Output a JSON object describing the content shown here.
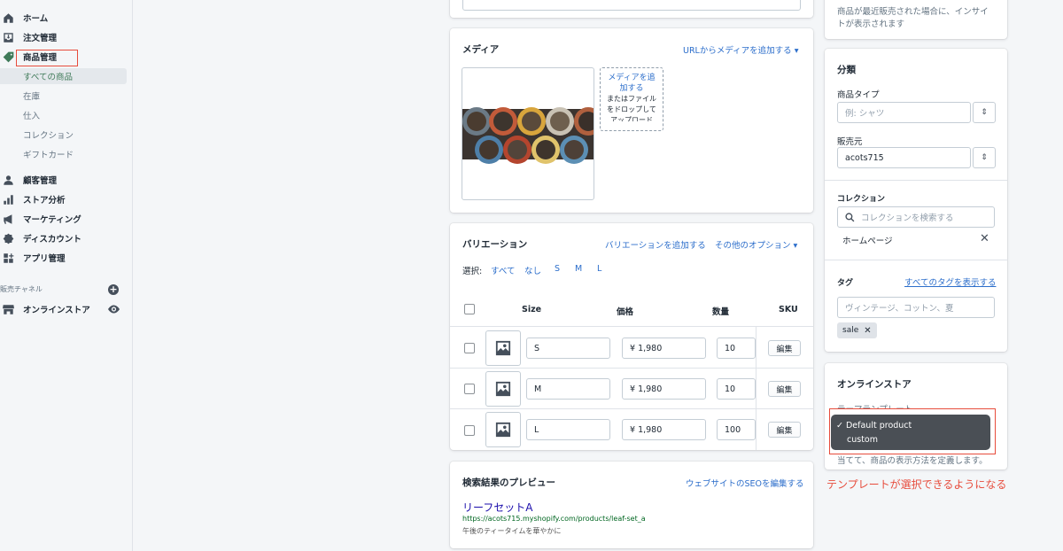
{
  "sidebar": {
    "items": [
      {
        "label": "ホーム",
        "icon": "home-icon"
      },
      {
        "label": "注文管理",
        "icon": "inbox-icon"
      },
      {
        "label": "商品管理",
        "icon": "tag-icon"
      },
      {
        "label": "顧客管理",
        "icon": "person-icon"
      },
      {
        "label": "ストア分析",
        "icon": "bar-chart-icon"
      },
      {
        "label": "マーケティング",
        "icon": "megaphone-icon"
      },
      {
        "label": "ディスカウント",
        "icon": "discount-icon"
      },
      {
        "label": "アプリ管理",
        "icon": "apps-icon"
      }
    ],
    "subitems": [
      "すべての商品",
      "在庫",
      "仕入",
      "コレクション",
      "ギフトカード"
    ],
    "channels_label": "販売チャネル",
    "online_store": "オンラインストア"
  },
  "media": {
    "title": "メディア",
    "add_url": "URLからメディアを追加する ▾",
    "drop_line1": "メディアを追",
    "drop_line2": "加する",
    "drop_line3": "またはファイル",
    "drop_line4": "をドロップして",
    "drop_line5": "アップロード"
  },
  "variants": {
    "title": "バリエーション",
    "add": "バリエーションを追加する",
    "more": "その他のオプション ▾",
    "select_label": "選択:",
    "select_options": [
      "すべて",
      "なし",
      "S",
      "M",
      "L"
    ],
    "headers": {
      "size": "Size",
      "price": "価格",
      "qty": "数量",
      "sku": "SKU"
    },
    "edit_label": "編集",
    "rows": [
      {
        "size": "S",
        "price": "¥  1,980",
        "qty": "10"
      },
      {
        "size": "M",
        "price": "¥  1,980",
        "qty": "10"
      },
      {
        "size": "L",
        "price": "¥  1,980",
        "qty": "100"
      }
    ]
  },
  "seo": {
    "title": "検索結果のプレビュー",
    "edit": "ウェブサイトのSEOを編集する",
    "page_title": "リーフセットA",
    "url": "https://acots715.myshopify.com/products/leaf-set_a",
    "description": "午後のティータイムを華やかに"
  },
  "insights": {
    "line1": "商品が最近販売された場合に、インサイ",
    "line2": "トが表示されます"
  },
  "org": {
    "title": "分類",
    "type_label": "商品タイプ",
    "type_placeholder": "例: シャツ",
    "vendor_label": "販売元",
    "vendor_value": "acots715",
    "collection_label": "コレクション",
    "collection_placeholder": "コレクションを検索する",
    "collection_item": "ホームページ",
    "tags_label": "タグ",
    "tags_link": "すべてのタグを表示する",
    "tags_placeholder": "ヴィンテージ、コットン、夏",
    "tag": "sale"
  },
  "online_store_card": {
    "title": "オンラインストア",
    "template_label": "テーマテンプレート",
    "options": [
      "✓ Default product",
      "custom"
    ],
    "help": "当てて、商品の表示方法を定義します。"
  },
  "annotation": "テンプレートが選択できるようになる",
  "colors": {
    "accent": "#2c6ecb",
    "annotation": "#e74c3c",
    "active": "#3f7a59"
  }
}
